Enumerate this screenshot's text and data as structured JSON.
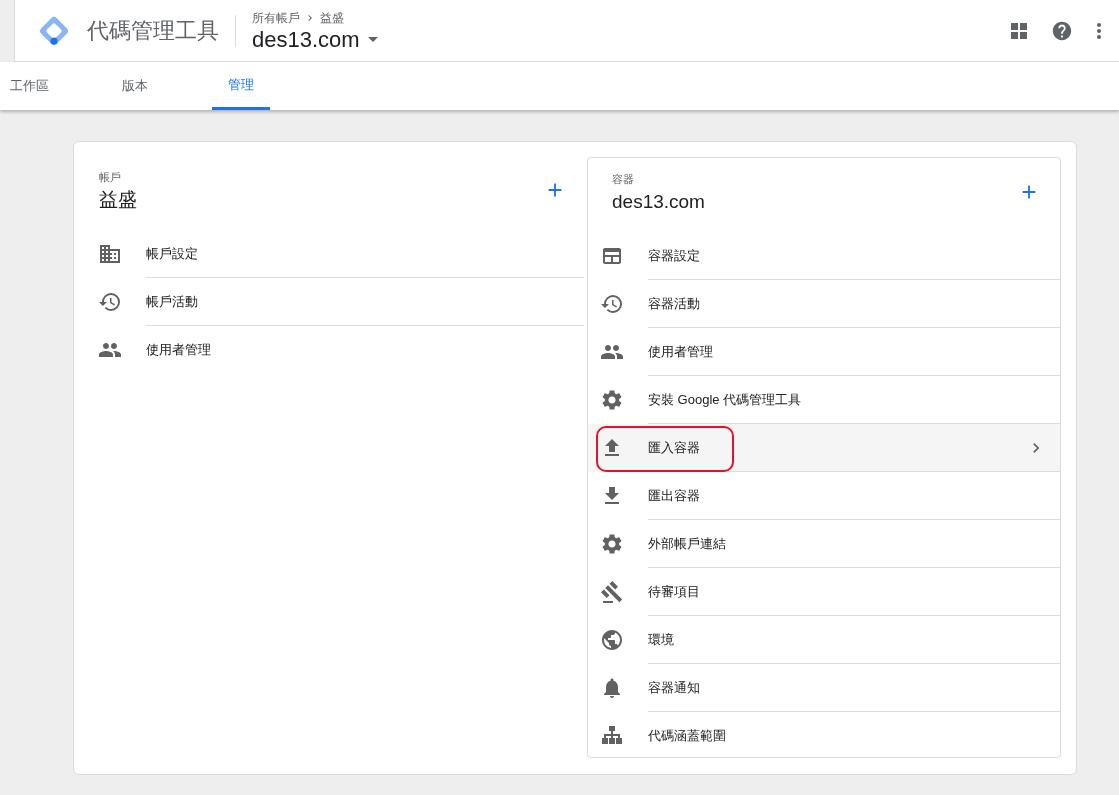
{
  "header": {
    "product_name": "代碼管理工具",
    "breadcrumb": [
      "所有帳戶",
      "益盛"
    ],
    "container_name": "des13.com"
  },
  "tabs": [
    {
      "label": "工作區",
      "selected": false
    },
    {
      "label": "版本",
      "selected": false
    },
    {
      "label": "管理",
      "selected": true
    }
  ],
  "account_panel": {
    "label": "帳戶",
    "name": "益盛",
    "items": [
      {
        "kind": "building",
        "label": "帳戶設定",
        "selected": false,
        "annotated": false
      },
      {
        "kind": "history",
        "label": "帳戶活動",
        "selected": false,
        "annotated": false
      },
      {
        "kind": "people",
        "label": "使用者管理",
        "selected": false,
        "annotated": false
      }
    ]
  },
  "container_panel": {
    "label": "容器",
    "name": "des13.com",
    "items": [
      {
        "kind": "window",
        "label": "容器設定",
        "selected": false,
        "annotated": false
      },
      {
        "kind": "history",
        "label": "容器活動",
        "selected": false,
        "annotated": false
      },
      {
        "kind": "people",
        "label": "使用者管理",
        "selected": false,
        "annotated": false
      },
      {
        "kind": "gear",
        "label": "安裝 Google 代碼管理工具",
        "selected": false,
        "annotated": false
      },
      {
        "kind": "upload",
        "label": "匯入容器",
        "selected": true,
        "annotated": true
      },
      {
        "kind": "download",
        "label": "匯出容器",
        "selected": false,
        "annotated": false
      },
      {
        "kind": "gear",
        "label": "外部帳戶連結",
        "selected": false,
        "annotated": false
      },
      {
        "kind": "gavel",
        "label": "待審項目",
        "selected": false,
        "annotated": false
      },
      {
        "kind": "globe",
        "label": "環境",
        "selected": false,
        "annotated": false
      },
      {
        "kind": "bell",
        "label": "容器通知",
        "selected": false,
        "annotated": false
      },
      {
        "kind": "sitemap",
        "label": "代碼涵蓋範圍",
        "selected": false,
        "annotated": false
      }
    ]
  }
}
